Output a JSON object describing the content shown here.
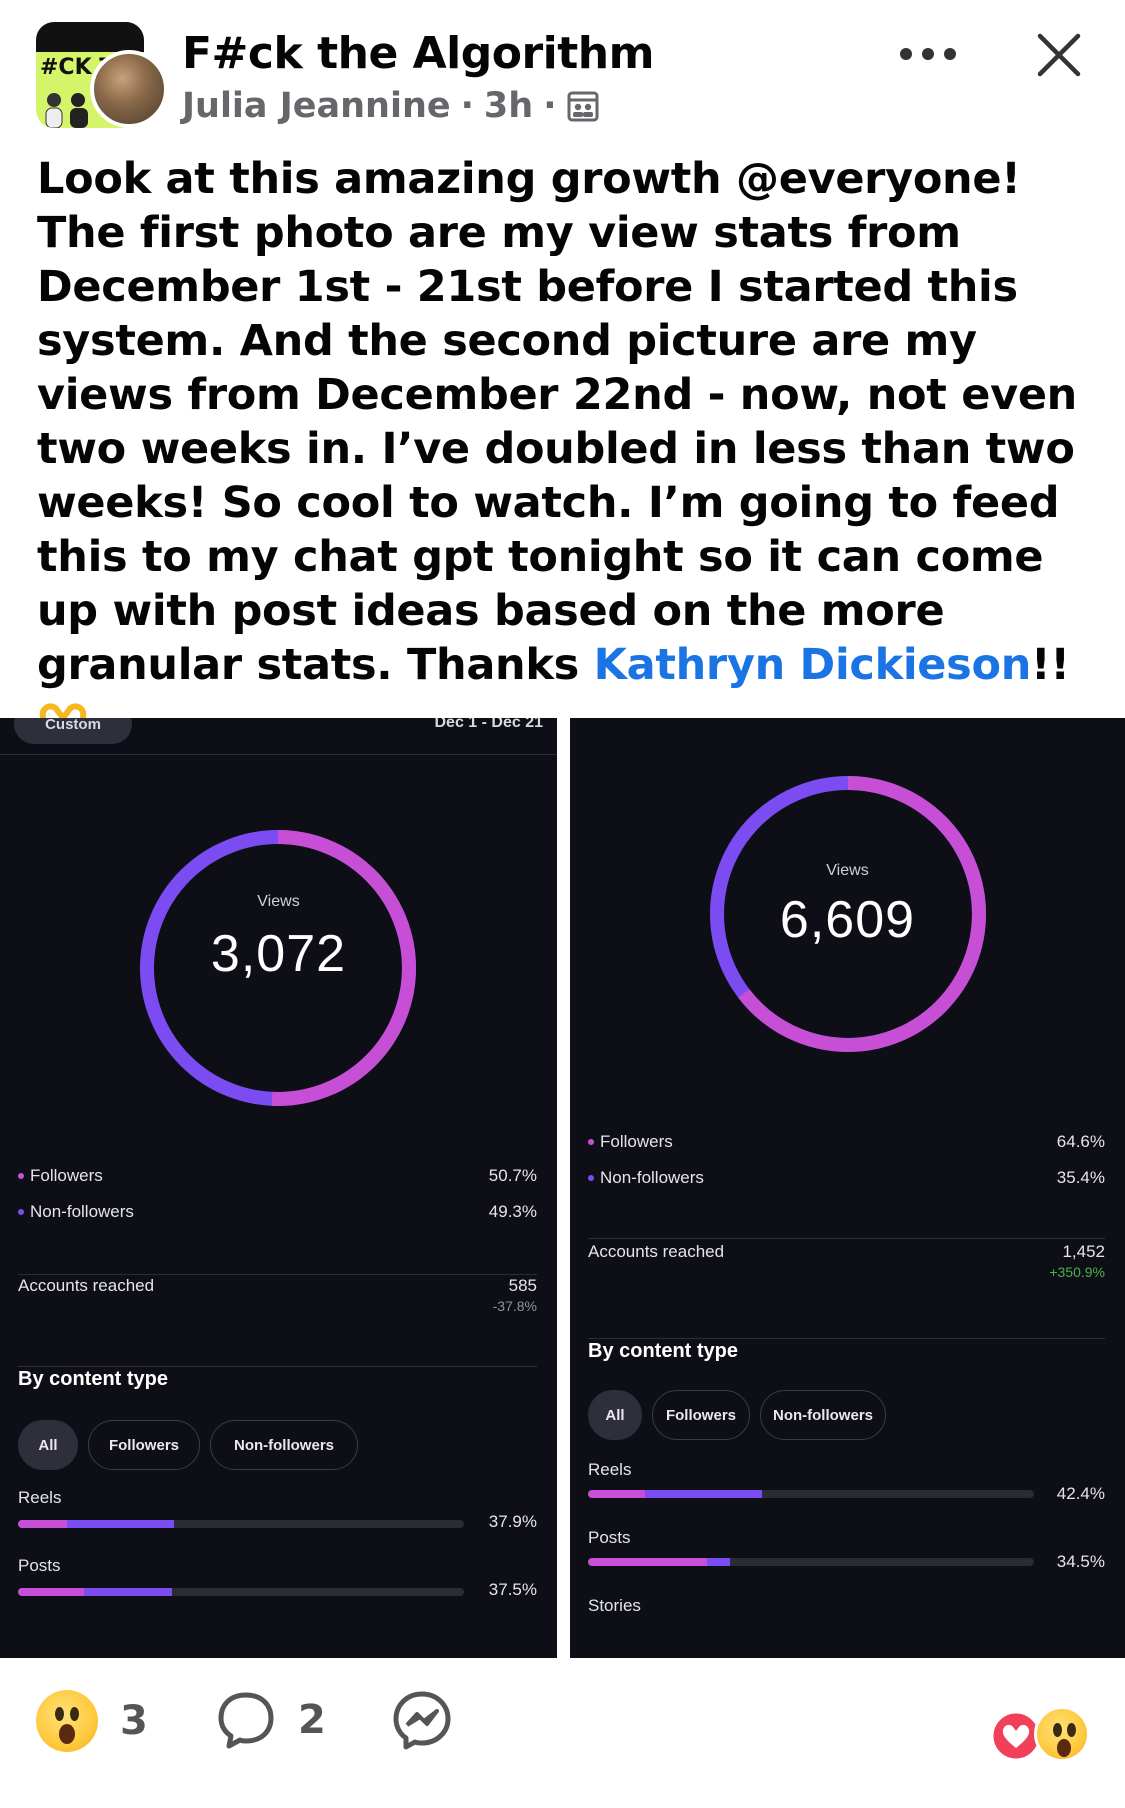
{
  "post": {
    "group_name": "F#ck the Algorithm",
    "group_avatar_text": "#CK TH",
    "author": "Julia Jeannine",
    "time": "3h",
    "body_before_mention": "Look at this amazing growth @everyone! The first photo are my view stats from December 1st - 21st before I started this system. And the second picture are my views from December 22nd - now, not even two weeks in. I’ve doubled in less than two weeks! So cool to watch. I’m going to feed this to my chat gpt tonight so it can come up with post ideas based on the more granular stats. Thanks ",
    "mention": "Kathryn Dickieson",
    "body_after_mention": "!!"
  },
  "screenshot_left": {
    "top_filter_label": "Custom",
    "top_date_range": "Dec 1 - Dec 21",
    "views_label": "Views",
    "views_value": "3,072",
    "followers_label": "Followers",
    "followers_pct": "50.7%",
    "nonfollowers_label": "Non-followers",
    "nonfollowers_pct": "49.3%",
    "followers_fraction": 0.507,
    "accounts_reached_label": "Accounts reached",
    "accounts_reached_value": "585",
    "accounts_reached_change": "-37.8%",
    "content_type_title": "By content type",
    "chip_all": "All",
    "chip_followers": "Followers",
    "chip_nonfollowers": "Non-followers",
    "bars": [
      {
        "label": "Reels",
        "pct": "37.9%",
        "value": 0.379,
        "followers_share": 0.12
      },
      {
        "label": "Posts",
        "pct": "37.5%",
        "value": 0.375,
        "followers_share": 0.16
      }
    ]
  },
  "screenshot_right": {
    "views_label": "Views",
    "views_value": "6,609",
    "followers_label": "Followers",
    "followers_pct": "64.6%",
    "nonfollowers_label": "Non-followers",
    "nonfollowers_pct": "35.4%",
    "followers_fraction": 0.646,
    "accounts_reached_label": "Accounts reached",
    "accounts_reached_value": "1,452",
    "accounts_reached_change": "+350.9%",
    "content_type_title": "By content type",
    "chip_all": "All",
    "chip_followers": "Followers",
    "chip_nonfollowers": "Non-followers",
    "bars": [
      {
        "label": "Reels",
        "pct": "42.4%",
        "value": 0.424,
        "followers_share": 0.14
      },
      {
        "label": "Posts",
        "pct": "34.5%",
        "value": 0.345,
        "followers_share": 0.29
      }
    ],
    "third_bar_label": "Stories"
  },
  "footer": {
    "reaction_count": "3",
    "comment_count": "2"
  },
  "colors": {
    "followers": "#c74fd6",
    "nonfollowers": "#7a4cf2",
    "positive": "#4caf50",
    "link": "#1b74e4"
  },
  "icons": [
    "privacy-icon",
    "more-icon",
    "close-icon",
    "wow-reaction-icon",
    "comment-icon",
    "messenger-icon",
    "love-reaction-icon",
    "heart-hands-emoji",
    "party-popper-emoji"
  ]
}
